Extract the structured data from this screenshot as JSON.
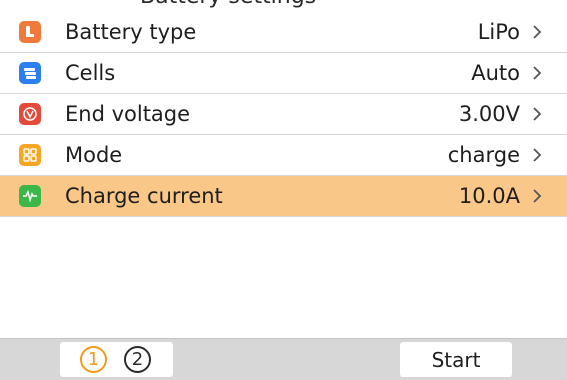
{
  "header": {
    "title": "Battery settings"
  },
  "menu": {
    "items": [
      {
        "label": "Battery type",
        "value": "LiPo",
        "icon": "battery-icon",
        "icon_color": "#f07a3b",
        "selected": false
      },
      {
        "label": "Cells",
        "value": "Auto",
        "icon": "cells-stack-icon",
        "icon_color": "#2d7ef0",
        "selected": false
      },
      {
        "label": "End voltage",
        "value": "3.00V",
        "icon": "voltage-icon",
        "icon_color": "#e34a3c",
        "selected": false
      },
      {
        "label": "Mode",
        "value": "charge",
        "icon": "mode-grid-icon",
        "icon_color": "#f5a623",
        "selected": false
      },
      {
        "label": "Charge current",
        "value": "10.0A",
        "icon": "pulse-icon",
        "icon_color": "#3cb84a",
        "selected": true
      }
    ]
  },
  "colors": {
    "selected_row": "#f9c787",
    "active_page": "#f39a1d",
    "bottom_bar": "#d7d7d7"
  },
  "bottom_bar": {
    "pages": [
      "1",
      "2"
    ],
    "active_page": 1,
    "start_label": "Start"
  }
}
